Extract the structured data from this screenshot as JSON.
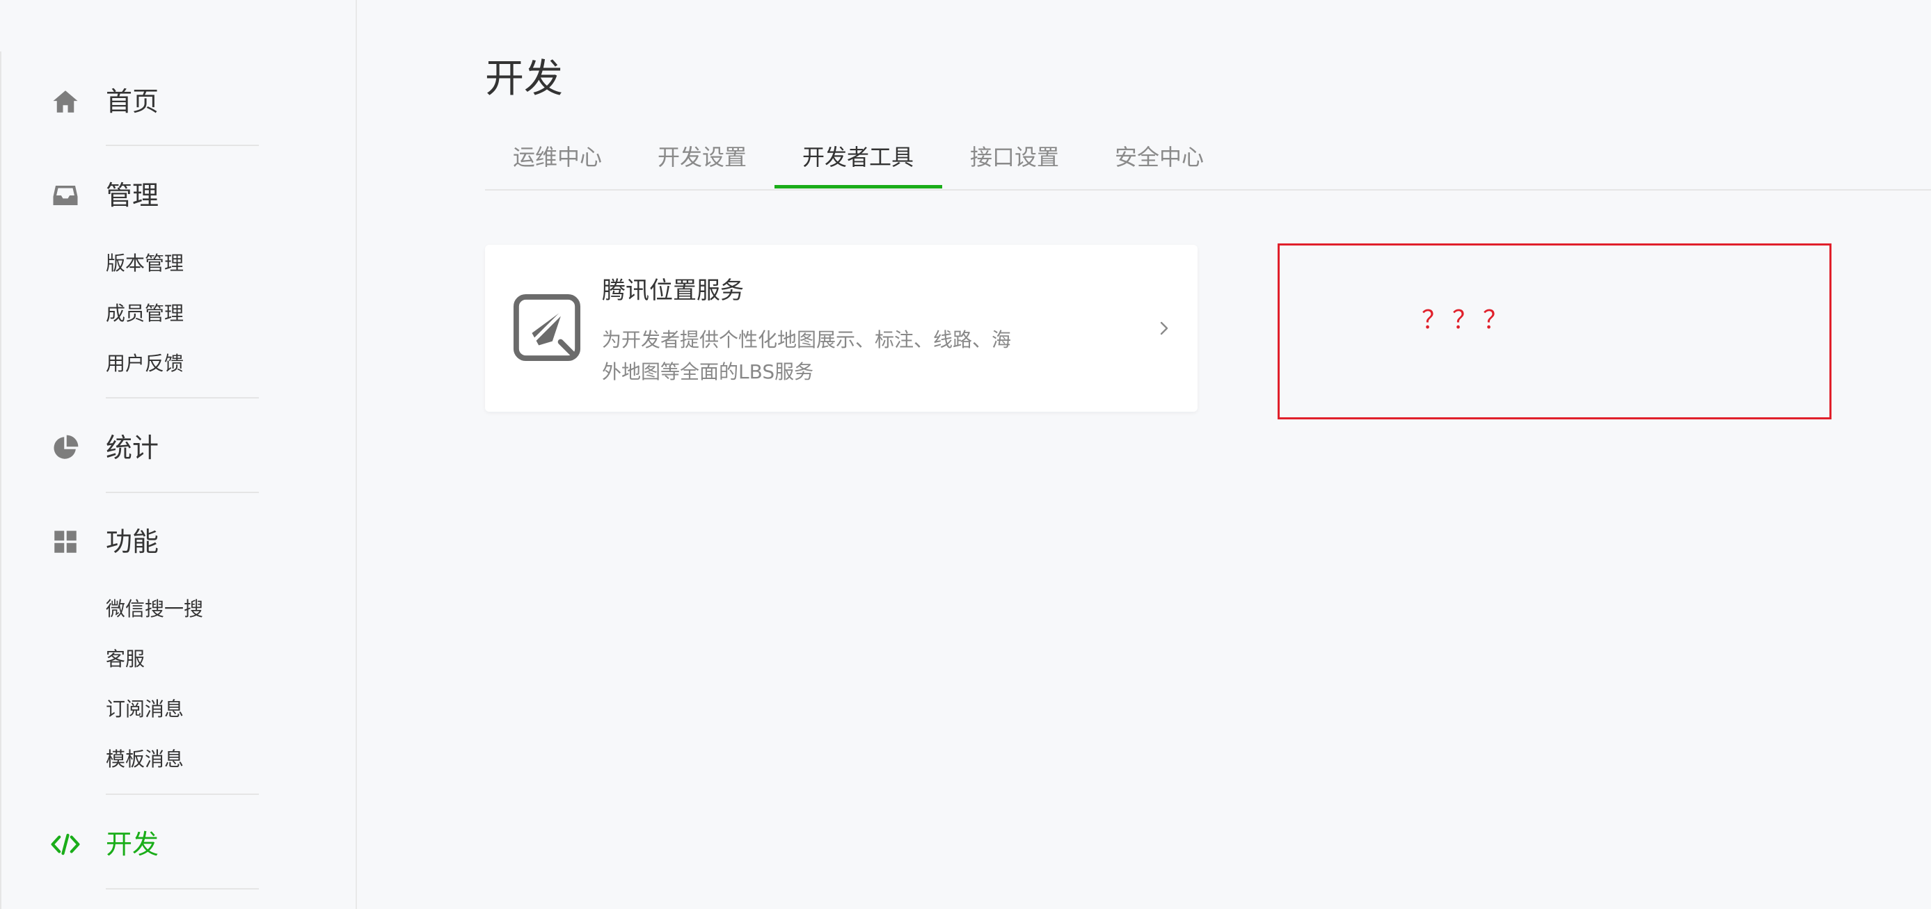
{
  "sidebar": {
    "home": {
      "label": "首页",
      "icon": "home-icon"
    },
    "manage": {
      "label": "管理",
      "icon": "inbox-icon",
      "items": [
        "版本管理",
        "成员管理",
        "用户反馈"
      ]
    },
    "stats": {
      "label": "统计",
      "icon": "pie-chart-icon"
    },
    "features": {
      "label": "功能",
      "icon": "grid-icon",
      "items": [
        "微信搜一搜",
        "客服",
        "订阅消息",
        "模板消息"
      ]
    },
    "develop": {
      "label": "开发",
      "icon": "code-icon",
      "active": true
    }
  },
  "page": {
    "title": "开发"
  },
  "tabs": [
    {
      "label": "运维中心",
      "active": false
    },
    {
      "label": "开发设置",
      "active": false
    },
    {
      "label": "开发者工具",
      "active": true
    },
    {
      "label": "接口设置",
      "active": false
    },
    {
      "label": "安全中心",
      "active": false
    }
  ],
  "service_card": {
    "title": "腾讯位置服务",
    "description": "为开发者提供个性化地图展示、标注、线路、海外地图等全面的LBS服务",
    "icon": "compass-icon",
    "arrow_icon": "chevron-right-icon"
  },
  "annotation": {
    "text": "？？？"
  },
  "colors": {
    "accent": "#1aad19",
    "background": "#f7f8fa",
    "annotation": "#e0202b",
    "icon_gray": "#6b6b6b"
  }
}
